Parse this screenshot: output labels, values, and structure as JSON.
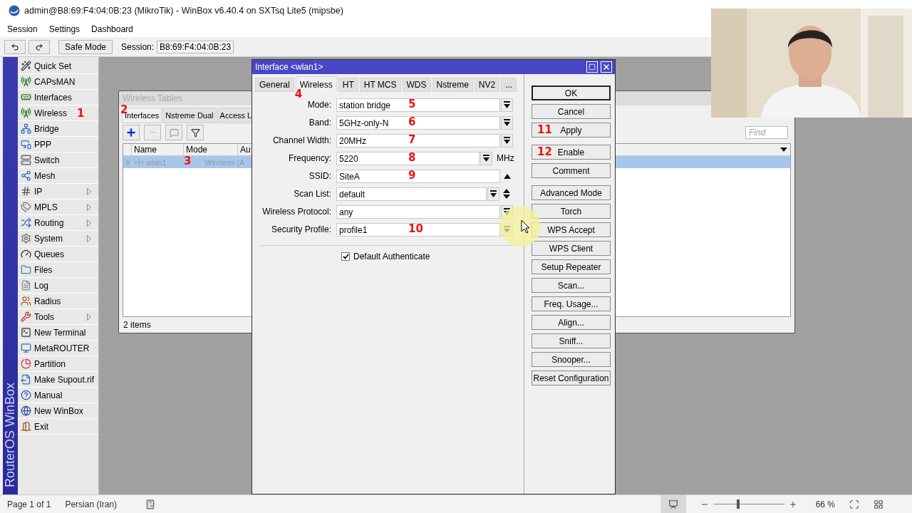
{
  "window": {
    "title": "admin@B8:69:F4:04:0B:23 (MikroTik) - WinBox v6.40.4 on SXTsq Lite5 (mipsbe)"
  },
  "menu": [
    "Session",
    "Settings",
    "Dashboard"
  ],
  "toolbar": {
    "safe_mode": "Safe Mode",
    "session_label": "Session:",
    "session_value": "B8:69:F4:04:0B:23"
  },
  "sidebar": {
    "brand": "RouterOS WinBox",
    "items": [
      {
        "label": "Quick Set",
        "submenu": false
      },
      {
        "label": "CAPsMAN",
        "submenu": false
      },
      {
        "label": "Interfaces",
        "submenu": false
      },
      {
        "label": "Wireless",
        "submenu": false,
        "marker": "1"
      },
      {
        "label": "Bridge",
        "submenu": false
      },
      {
        "label": "PPP",
        "submenu": false
      },
      {
        "label": "Switch",
        "submenu": false
      },
      {
        "label": "Mesh",
        "submenu": false
      },
      {
        "label": "IP",
        "submenu": true
      },
      {
        "label": "MPLS",
        "submenu": true
      },
      {
        "label": "Routing",
        "submenu": true
      },
      {
        "label": "System",
        "submenu": true
      },
      {
        "label": "Queues",
        "submenu": false
      },
      {
        "label": "Files",
        "submenu": false
      },
      {
        "label": "Log",
        "submenu": false
      },
      {
        "label": "Radius",
        "submenu": false
      },
      {
        "label": "Tools",
        "submenu": true
      },
      {
        "label": "New Terminal",
        "submenu": false
      },
      {
        "label": "MetaROUTER",
        "submenu": false
      },
      {
        "label": "Partition",
        "submenu": false
      },
      {
        "label": "Make Supout.rif",
        "submenu": false
      },
      {
        "label": "Manual",
        "submenu": false
      },
      {
        "label": "New WinBox",
        "submenu": false
      },
      {
        "label": "Exit",
        "submenu": false
      }
    ]
  },
  "wireless_tables": {
    "title": "Wireless Tables",
    "tabs_marker": "2",
    "tabs": [
      {
        "label": "Interfaces",
        "selected": true
      },
      {
        "label": "Nstreme Dual",
        "selected": false
      },
      {
        "label": "Access L",
        "selected": false
      }
    ],
    "find": {
      "placeholder": "Find"
    },
    "columns": [
      "",
      "Name",
      "Mode",
      "Au"
    ],
    "rows": [
      {
        "cells": [
          "X",
          "wlan1",
          "Wireless (A"
        ],
        "selected": true,
        "disabled": true,
        "marker": "3"
      }
    ],
    "status": "2 items"
  },
  "dialog": {
    "title": "Interface <wlan1>",
    "tabs": [
      {
        "label": "General",
        "selected": false
      },
      {
        "label": "Wireless",
        "selected": true,
        "marker": "4"
      },
      {
        "label": "HT",
        "selected": false
      },
      {
        "label": "HT MCS",
        "selected": false
      },
      {
        "label": "WDS",
        "selected": false
      },
      {
        "label": "Nstreme",
        "selected": false
      },
      {
        "label": "NV2",
        "selected": false
      },
      {
        "label": "...",
        "selected": false
      }
    ],
    "fields": [
      {
        "label": "Mode:",
        "value": "station bridge",
        "kind": "dropdown",
        "marker": "5"
      },
      {
        "label": "Band:",
        "value": "5GHz-only-N",
        "kind": "dropdown",
        "marker": "6"
      },
      {
        "label": "Channel Width:",
        "value": "20MHz",
        "kind": "dropdown",
        "marker": "7"
      },
      {
        "label": "Frequency:",
        "value": "5220",
        "kind": "unit",
        "unit": "MHz",
        "marker": "8"
      },
      {
        "label": "SSID:",
        "value": "SiteA",
        "kind": "collapse",
        "marker": "9"
      },
      {
        "label": "Scan List:",
        "value": "default",
        "kind": "list"
      },
      {
        "label": "Wireless Protocol:",
        "value": "any",
        "kind": "dropdown"
      },
      {
        "label": "Security Profile:",
        "value": "profile1",
        "kind": "dropdown",
        "marker": "10"
      }
    ],
    "checkbox": {
      "label": "Default Authenticate",
      "checked": true
    },
    "button_groups": [
      [
        {
          "label": "OK",
          "default": true
        },
        {
          "label": "Cancel",
          "default": false
        },
        {
          "label": "Apply",
          "default": false,
          "marker": "11"
        }
      ],
      [
        {
          "label": "Enable",
          "default": false,
          "marker": "12"
        },
        {
          "label": "Comment",
          "default": false
        }
      ],
      [
        {
          "label": "Advanced Mode",
          "default": false
        },
        {
          "label": "Torch",
          "default": false
        },
        {
          "label": "WPS Accept",
          "default": false
        },
        {
          "label": "WPS Client",
          "default": false
        },
        {
          "label": "Setup Repeater",
          "default": false
        },
        {
          "label": "Scan...",
          "default": false
        },
        {
          "label": "Freq. Usage...",
          "default": false
        },
        {
          "label": "Align...",
          "default": false
        },
        {
          "label": "Sniff...",
          "default": false
        },
        {
          "label": "Snooper...",
          "default": false
        },
        {
          "label": "Reset Configuration",
          "default": false
        }
      ]
    ]
  },
  "status_bar": {
    "page": "Page 1 of 1",
    "language": "Persian (Iran)",
    "zoom": {
      "level": 0.35,
      "reading": "66 %"
    }
  },
  "webcam": {
    "kind": "picture"
  }
}
